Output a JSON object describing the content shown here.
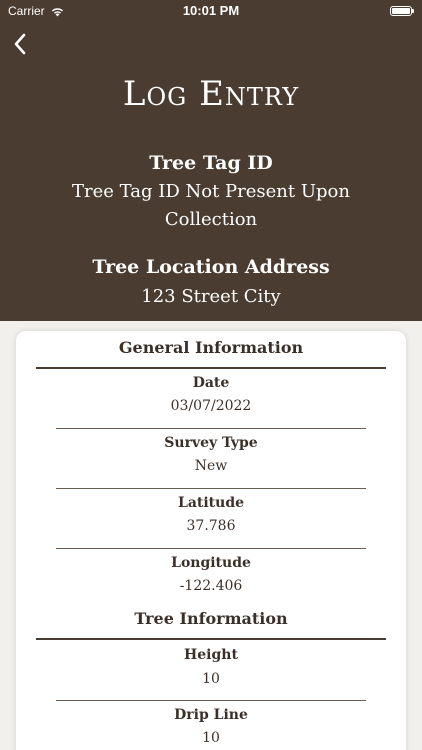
{
  "status": {
    "carrier": "Carrier",
    "time": "10:01 PM"
  },
  "header": {
    "title": "Log Entry",
    "tag_label": "Tree Tag ID",
    "tag_value": "Tree Tag ID Not Present Upon Collection",
    "address_label": "Tree Location Address",
    "address_value": "123 Street City"
  },
  "general": {
    "title": "General Information",
    "date_label": "Date",
    "date_value": "03/07/2022",
    "survey_label": "Survey Type",
    "survey_value": "New",
    "lat_label": "Latitude",
    "lat_value": "37.786",
    "lon_label": "Longitude",
    "lon_value": "-122.406"
  },
  "tree": {
    "title": "Tree Information",
    "height_label": "Height",
    "height_value": "10",
    "drip_label": "Drip Line",
    "drip_value": "10"
  },
  "colors": {
    "header_bg": "#4a3c30",
    "text_dark": "#3b3029",
    "page_bg": "#f2f0ed"
  }
}
